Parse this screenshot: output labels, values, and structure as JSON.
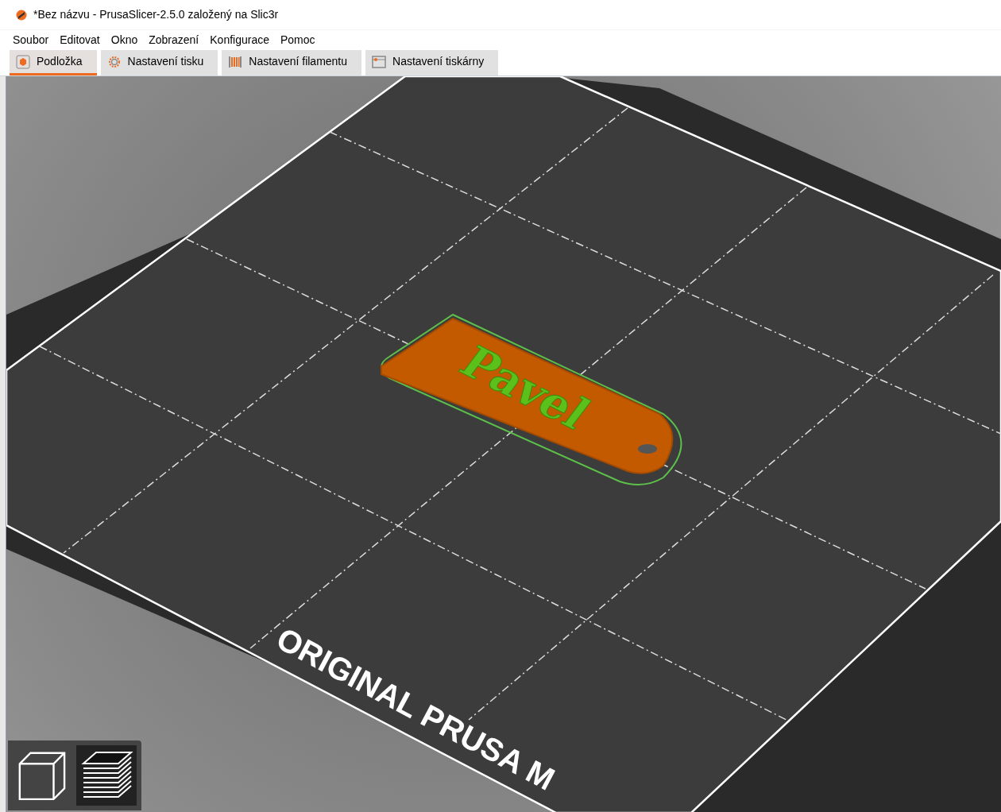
{
  "window": {
    "title": "*Bez názvu - PrusaSlicer-2.5.0 založený na Slic3r"
  },
  "menu": [
    "Soubor",
    "Editovat",
    "Okno",
    "Zobrazení",
    "Konfigurace",
    "Pomoc"
  ],
  "tabs": [
    {
      "label": "Podložka",
      "kind": "plater",
      "selected": true
    },
    {
      "label": "Nastavení tisku",
      "kind": "print",
      "selected": false
    },
    {
      "label": "Nastavení filamentu",
      "kind": "filament",
      "selected": false
    },
    {
      "label": "Nastavení tiskárny",
      "kind": "printer",
      "selected": false
    }
  ],
  "viewport": {
    "bed_label": "ORIGINAL PRUSA M",
    "model_text": "Pavel"
  },
  "view_buttons": [
    {
      "kind": "solid",
      "selected": false
    },
    {
      "kind": "preview",
      "selected": true
    }
  ]
}
